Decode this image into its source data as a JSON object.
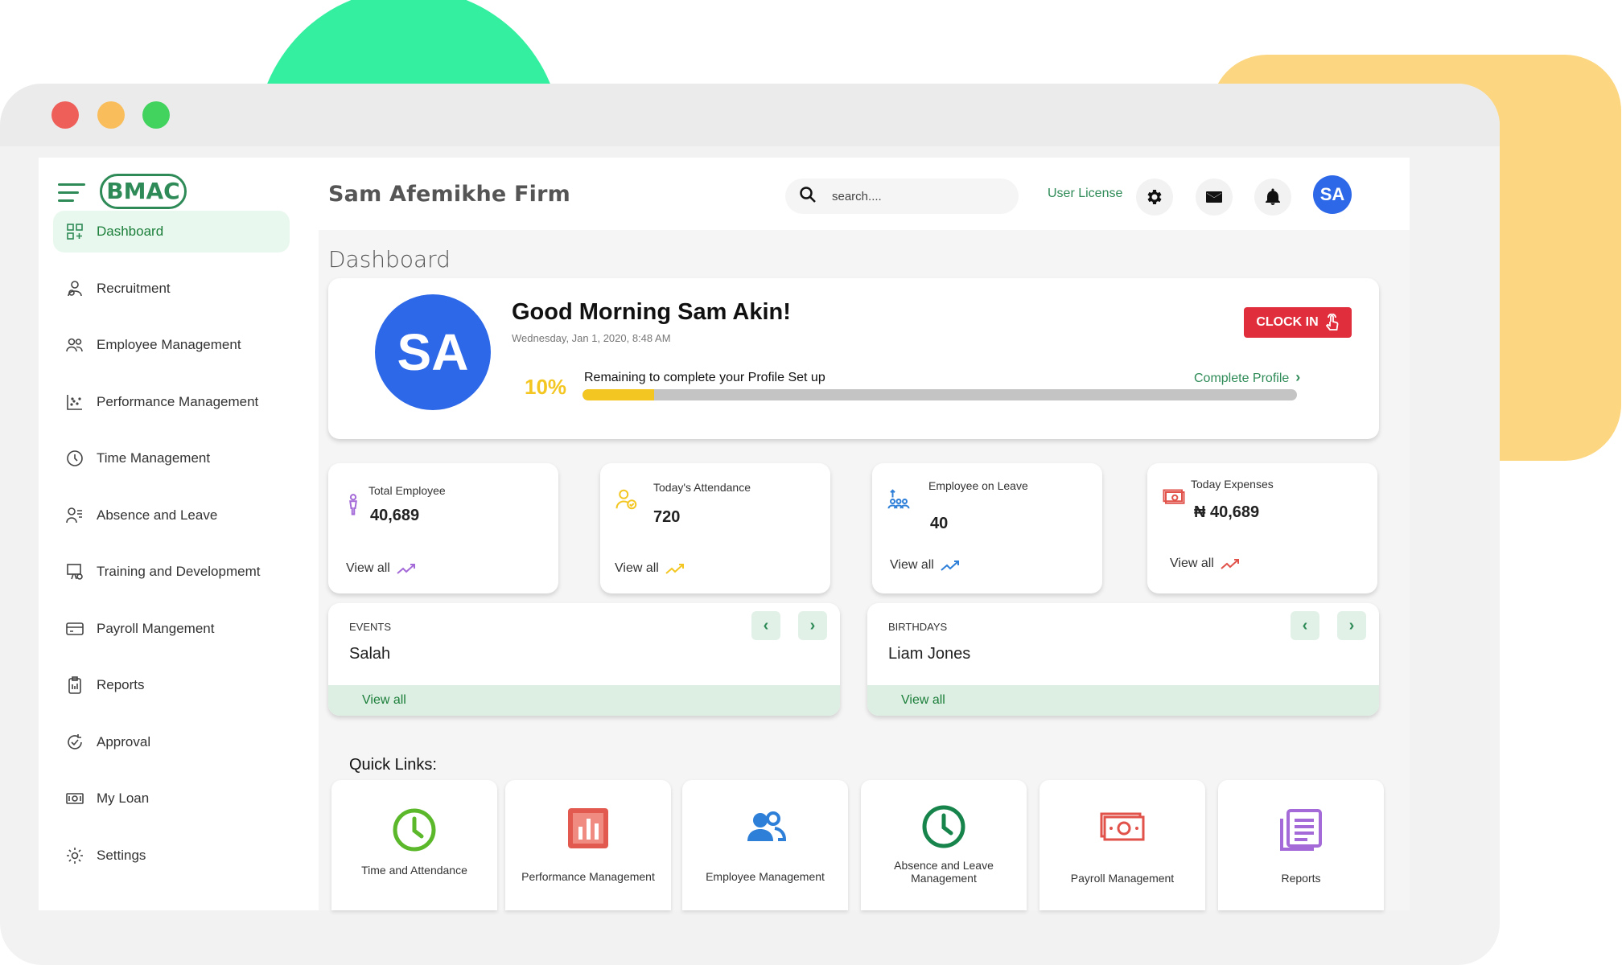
{
  "window": {
    "colors": {
      "close": "#ef5f5a",
      "minimize": "#f9bd5b",
      "maximize": "#42d35f"
    }
  },
  "brand": {
    "logo_text": "BMAC",
    "accent": "#2e8b57"
  },
  "sidebar": {
    "items": [
      {
        "label": "Dashboard",
        "icon": "dashboard-icon",
        "active": true
      },
      {
        "label": "Recruitment",
        "icon": "recruitment-icon"
      },
      {
        "label": "Employee Management",
        "icon": "users-icon"
      },
      {
        "label": "Performance Management",
        "icon": "scatter-chart-icon"
      },
      {
        "label": "Time Management",
        "icon": "clock-icon"
      },
      {
        "label": "Absence and Leave",
        "icon": "user-list-icon"
      },
      {
        "label": "Training and Developmemt",
        "icon": "training-icon"
      },
      {
        "label": "Payroll Mangement",
        "icon": "card-icon"
      },
      {
        "label": "Reports",
        "icon": "clipboard-icon"
      },
      {
        "label": "Approval",
        "icon": "approval-icon"
      },
      {
        "label": "My Loan",
        "icon": "money-icon"
      },
      {
        "label": "Settings",
        "icon": "gear-icon"
      }
    ]
  },
  "header": {
    "firm_name": "Sam Afemikhe Firm",
    "search_placeholder": "search....",
    "user_license": "User License",
    "avatar_initials": "SA"
  },
  "page": {
    "title": "Dashboard"
  },
  "welcome": {
    "initials": "SA",
    "greeting": "Good Morning Sam Akin!",
    "date": "Wednesday, Jan 1, 2020, 8:48 AM",
    "clock_in_label": "CLOCK IN",
    "progress_percent_label": "10%",
    "progress_fraction": 0.1,
    "progress_text": "Remaining to complete your Profile Set up",
    "complete_profile_label": "Complete Profile"
  },
  "stats": [
    {
      "title": "Total Employee",
      "value": "40,689",
      "view": "View all",
      "icon": "person-icon",
      "color": "#a46ad8"
    },
    {
      "title": "Today's Attendance",
      "value": "720",
      "view": "View all",
      "icon": "attendance-icon",
      "color": "#f3c622"
    },
    {
      "title": "Employee on Leave",
      "value": "40",
      "view": "View all",
      "icon": "group-leave-icon",
      "color": "#2d7fd8"
    },
    {
      "title": "Today Expenses",
      "value": "₦ 40,689",
      "view": "View all",
      "icon": "cash-icon",
      "color": "#e0524a"
    }
  ],
  "events": {
    "label": "EVENTS",
    "name": "Salah",
    "view": "View all"
  },
  "birthdays": {
    "label": "BIRTHDAYS",
    "name": "Liam Jones",
    "view": "View all"
  },
  "quick_links": {
    "title": "Quick Links:",
    "items": [
      {
        "label": "Time and Attendance",
        "icon": "clock-icon",
        "color": "#5cb82b"
      },
      {
        "label": "Performance Management",
        "icon": "bar-chart-icon",
        "color": "#e25a4f"
      },
      {
        "label": "Employee Management",
        "icon": "users-icon",
        "color": "#2d7fd8"
      },
      {
        "label": "Absence and Leave Management",
        "icon": "clock-icon",
        "color": "#17844c"
      },
      {
        "label": "Payroll Management",
        "icon": "cash-icon",
        "color": "#e0524a"
      },
      {
        "label": "Reports",
        "icon": "report-icon",
        "color": "#a46ad8"
      }
    ]
  }
}
